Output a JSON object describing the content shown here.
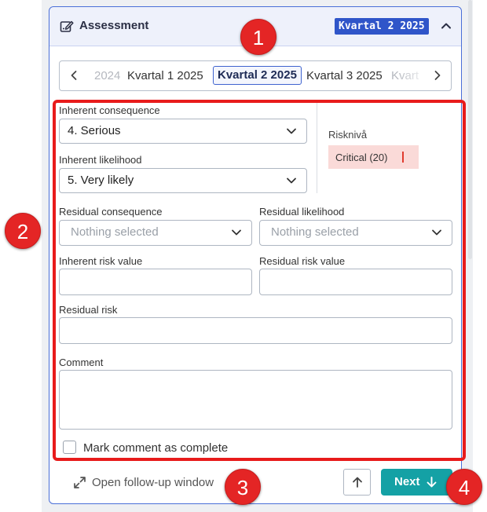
{
  "header": {
    "title": "Assessment",
    "period_badge": "Kvartal 2 2025"
  },
  "period_tabs": [
    {
      "label": "2024",
      "state": "faded"
    },
    {
      "label": "Kvartal 1 2025",
      "state": "normal"
    },
    {
      "label": "Kvartal 2 2025",
      "state": "active"
    },
    {
      "label": "Kvartal 3 2025",
      "state": "normal"
    },
    {
      "label": "Kvart",
      "state": "faded"
    }
  ],
  "form": {
    "inherent_consequence": {
      "label": "Inherent consequence",
      "value": "4. Serious"
    },
    "inherent_likelihood": {
      "label": "Inherent likelihood",
      "value": "5. Very likely"
    },
    "risk_level": {
      "label": "Risknivå",
      "value": "Critical (20)"
    },
    "residual_consequence": {
      "label": "Residual consequence",
      "placeholder": "Nothing selected"
    },
    "residual_likelihood": {
      "label": "Residual likelihood",
      "placeholder": "Nothing selected"
    },
    "inherent_risk_value": {
      "label": "Inherent risk value",
      "value": ""
    },
    "residual_risk_value": {
      "label": "Residual risk value",
      "value": ""
    },
    "residual_risk": {
      "label": "Residual risk",
      "value": ""
    },
    "comment": {
      "label": "Comment",
      "value": ""
    },
    "mark_complete": {
      "label": "Mark comment as complete",
      "checked": false
    }
  },
  "footer": {
    "open_follow_up": "Open follow-up window",
    "next_label": "Next"
  },
  "annotations": [
    "1",
    "2",
    "3",
    "4"
  ],
  "colors": {
    "accent": "#2f55c9",
    "next_button": "#14a1a5",
    "highlight": "#e81b1b",
    "risk_critical_bg": "#fadad8"
  },
  "icons": [
    "edit-icon",
    "chevron-up-icon",
    "chevron-left-icon",
    "chevron-right-icon",
    "chevron-down-icon",
    "expand-icon",
    "arrow-up-icon",
    "arrow-down-icon"
  ]
}
